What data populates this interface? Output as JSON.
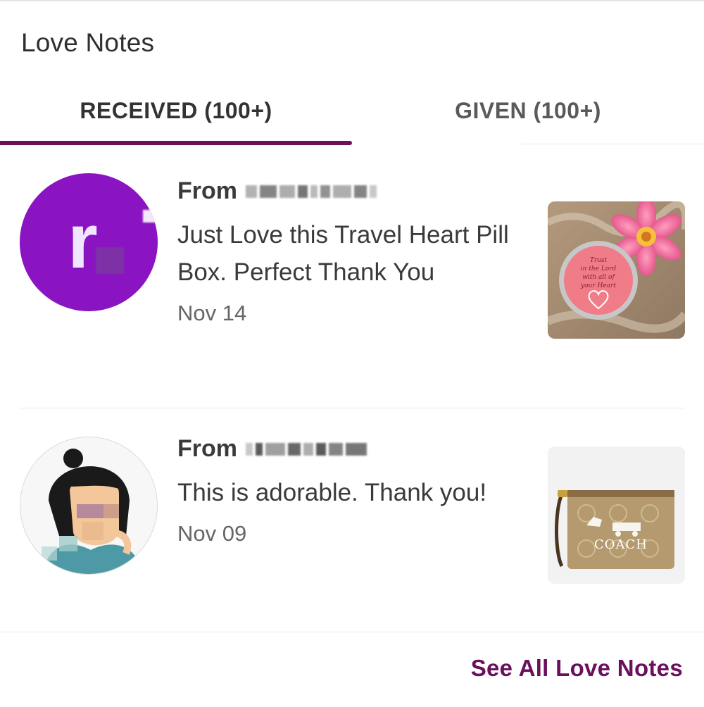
{
  "header": {
    "title": "Love Notes"
  },
  "tabs": [
    {
      "label": "RECEIVED (100+)",
      "active": true
    },
    {
      "label": "GIVEN (100+)",
      "active": false
    }
  ],
  "notes": [
    {
      "from_label": "From",
      "message": "Just Love this Travel Heart Pill Box. Perfect Thank You",
      "date": "Nov 14",
      "avatar_letter": "r",
      "avatar_color": "#8a13c2",
      "product_icon": "heart-pill-box-image",
      "product_text": [
        "Trust",
        "in the Lord",
        "with all of",
        "your Heart"
      ]
    },
    {
      "from_label": "From",
      "message": "This is adorable. Thank you!",
      "date": "Nov 09",
      "avatar_icon": "cartoon-avatar-image",
      "product_icon": "coach-wristlet-image",
      "product_brand": "COACH"
    }
  ],
  "footer": {
    "see_all_label": "See All Love Notes",
    "accent_color": "#6b0f5e"
  }
}
